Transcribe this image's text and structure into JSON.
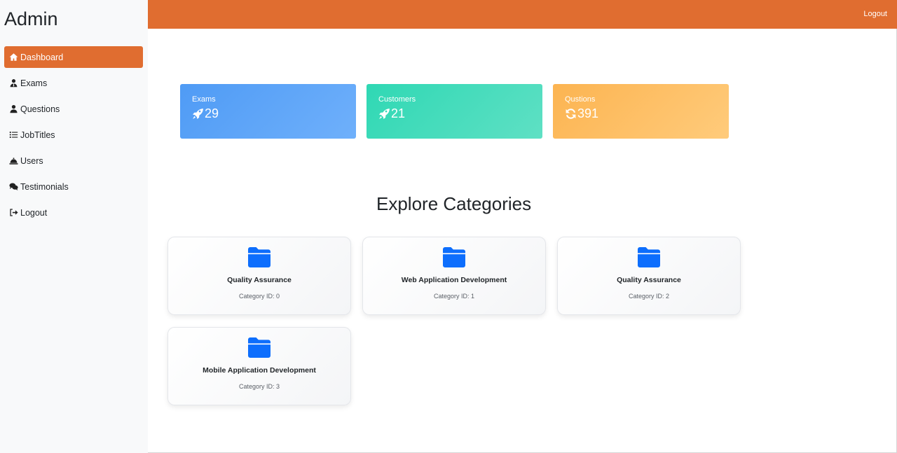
{
  "brand": "Admin",
  "sidebar": {
    "items": [
      {
        "label": "Dashboard",
        "icon": "home-icon",
        "active": true
      },
      {
        "label": "Exams",
        "icon": "user-tie-icon",
        "active": false
      },
      {
        "label": "Questions",
        "icon": "user-icon",
        "active": false
      },
      {
        "label": "JobTitles",
        "icon": "list-icon",
        "active": false
      },
      {
        "label": "Users",
        "icon": "bell-concierge-icon",
        "active": false
      },
      {
        "label": "Testimonials",
        "icon": "comments-icon",
        "active": false
      },
      {
        "label": "Logout",
        "icon": "sign-out-icon",
        "active": false
      }
    ]
  },
  "topbar": {
    "logout_label": "Logout"
  },
  "stats": [
    {
      "label": "Exams",
      "value": "29",
      "icon": "rocket-icon"
    },
    {
      "label": "Customers",
      "value": "21",
      "icon": "rocket-icon"
    },
    {
      "label": "Qustions",
      "value": "391",
      "icon": "refresh-icon"
    }
  ],
  "section": {
    "title": "Explore Categories"
  },
  "categories": [
    {
      "name": "Quality Assurance",
      "id_text": "Category ID: 0"
    },
    {
      "name": "Web Application Development",
      "id_text": "Category ID: 1"
    },
    {
      "name": "Quality Assurance",
      "id_text": "Category ID: 2"
    },
    {
      "name": "Mobile Application Development",
      "id_text": "Category ID: 3"
    }
  ],
  "colors": {
    "accent": "#e06d30",
    "sidebar_bg": "#f8f9fa",
    "stat_blue": "#4f9bf5",
    "stat_green": "#2fd8b4",
    "stat_orange": "#fcb451",
    "folder_blue": "#0d6efd"
  }
}
